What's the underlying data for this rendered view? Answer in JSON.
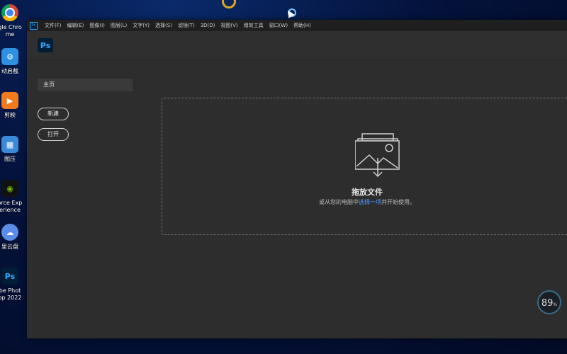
{
  "desktop": {
    "icons": [
      {
        "name": "chrome-icon",
        "glyph": "",
        "label1": "gle Chro",
        "label2": "me",
        "color": "#ffffff"
      },
      {
        "name": "auto-app-icon",
        "glyph": "",
        "label1": "动启截",
        "label2": "",
        "color": "#2f8fe0"
      },
      {
        "name": "video-app-icon",
        "glyph": "▶",
        "label1": "剪映",
        "label2": "",
        "color": "#f07a1e"
      },
      {
        "name": "compress-app-icon",
        "glyph": "",
        "label1": "图压",
        "label2": "",
        "color": "#3a89d8"
      },
      {
        "name": "geforce-icon",
        "glyph": "",
        "label1": "orce Exp",
        "label2": "erience",
        "color": "#111111"
      },
      {
        "name": "cloud-drive-icon",
        "glyph": "",
        "label1": "里云盘",
        "label2": "",
        "color": "#5a8de8"
      },
      {
        "name": "photoshop-desktop-icon",
        "glyph": "Ps",
        "label1": "be Phot",
        "label2": "op 2022",
        "color": "#001e36"
      }
    ]
  },
  "ps": {
    "mini_logo": "Ps",
    "menu": [
      "文件(F)",
      "编辑(E)",
      "图像(I)",
      "图层(L)",
      "文字(Y)",
      "选择(S)",
      "滤镜(T)",
      "3D(D)",
      "视图(V)",
      "增效工具",
      "窗口(W)",
      "帮助(H)"
    ],
    "logo": "Ps",
    "home_tab": "主页",
    "new_button": "新建",
    "open_button": "打开",
    "drop_title": "拖放文件",
    "drop_sub_before": "或从您的电脑中",
    "drop_sub_link": "选择一项",
    "drop_sub_after": "并开始使用。"
  },
  "perf": {
    "value": "89",
    "unit": "%"
  },
  "colors": {
    "ps_blue": "#31a8ff",
    "ps_dark": "#001e36",
    "link": "#4aa0ff"
  }
}
